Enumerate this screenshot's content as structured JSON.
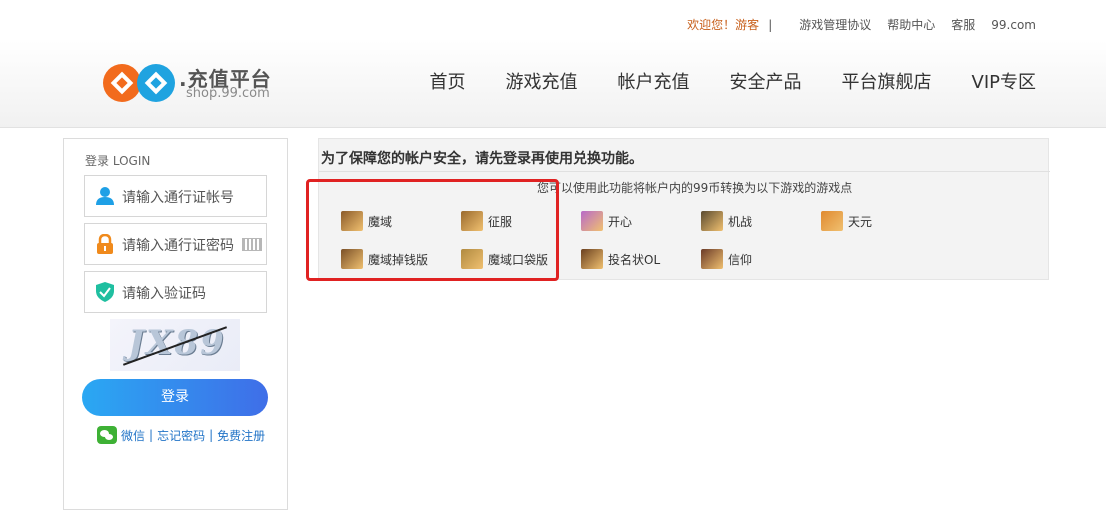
{
  "topbar": {
    "welcome": "欢迎您！游客",
    "separator": "|",
    "links": [
      "游戏管理协议",
      "帮助中心",
      "客服",
      "99.com"
    ]
  },
  "logo": {
    "title": ".充值平台",
    "subtitle": "shop.99.com"
  },
  "nav": [
    "首页",
    "游戏充值",
    "帐户充值",
    "安全产品",
    "平台旗舰店",
    "VIP专区"
  ],
  "login": {
    "title": "登录 LOGIN",
    "account_placeholder": "请输入通行证帐号",
    "password_placeholder": "请输入通行证密码",
    "captcha_placeholder": "请输入验证码",
    "captcha_text": "JX89",
    "button": "登录",
    "wechat": "微信",
    "forgot": "忘记密码",
    "register": "免费注册"
  },
  "main": {
    "title": "为了保障您的帐户安全，请先登录再使用兑换功能。",
    "note": "您可以使用此功能将帐户内的99币转换为以下游戏的游戏点",
    "games": [
      {
        "name": "魔域",
        "color": "#8a5a2a"
      },
      {
        "name": "征服",
        "color": "#9a6a2e"
      },
      {
        "name": "开心",
        "color": "#b86ac8"
      },
      {
        "name": "机战",
        "color": "#5a4a30"
      },
      {
        "name": "天元",
        "color": "#e08a30"
      },
      {
        "name": "魔域掉钱版",
        "color": "#7a5028"
      },
      {
        "name": "魔域口袋版",
        "color": "#b08a40"
      },
      {
        "name": "投名状OL",
        "color": "#6a4020"
      },
      {
        "name": "信仰",
        "color": "#6a3a28"
      }
    ]
  },
  "colors": {
    "accent": "#c8601c",
    "button_start": "#2aa8f3",
    "button_end": "#3f6ee8",
    "highlight_box": "#e02222"
  }
}
